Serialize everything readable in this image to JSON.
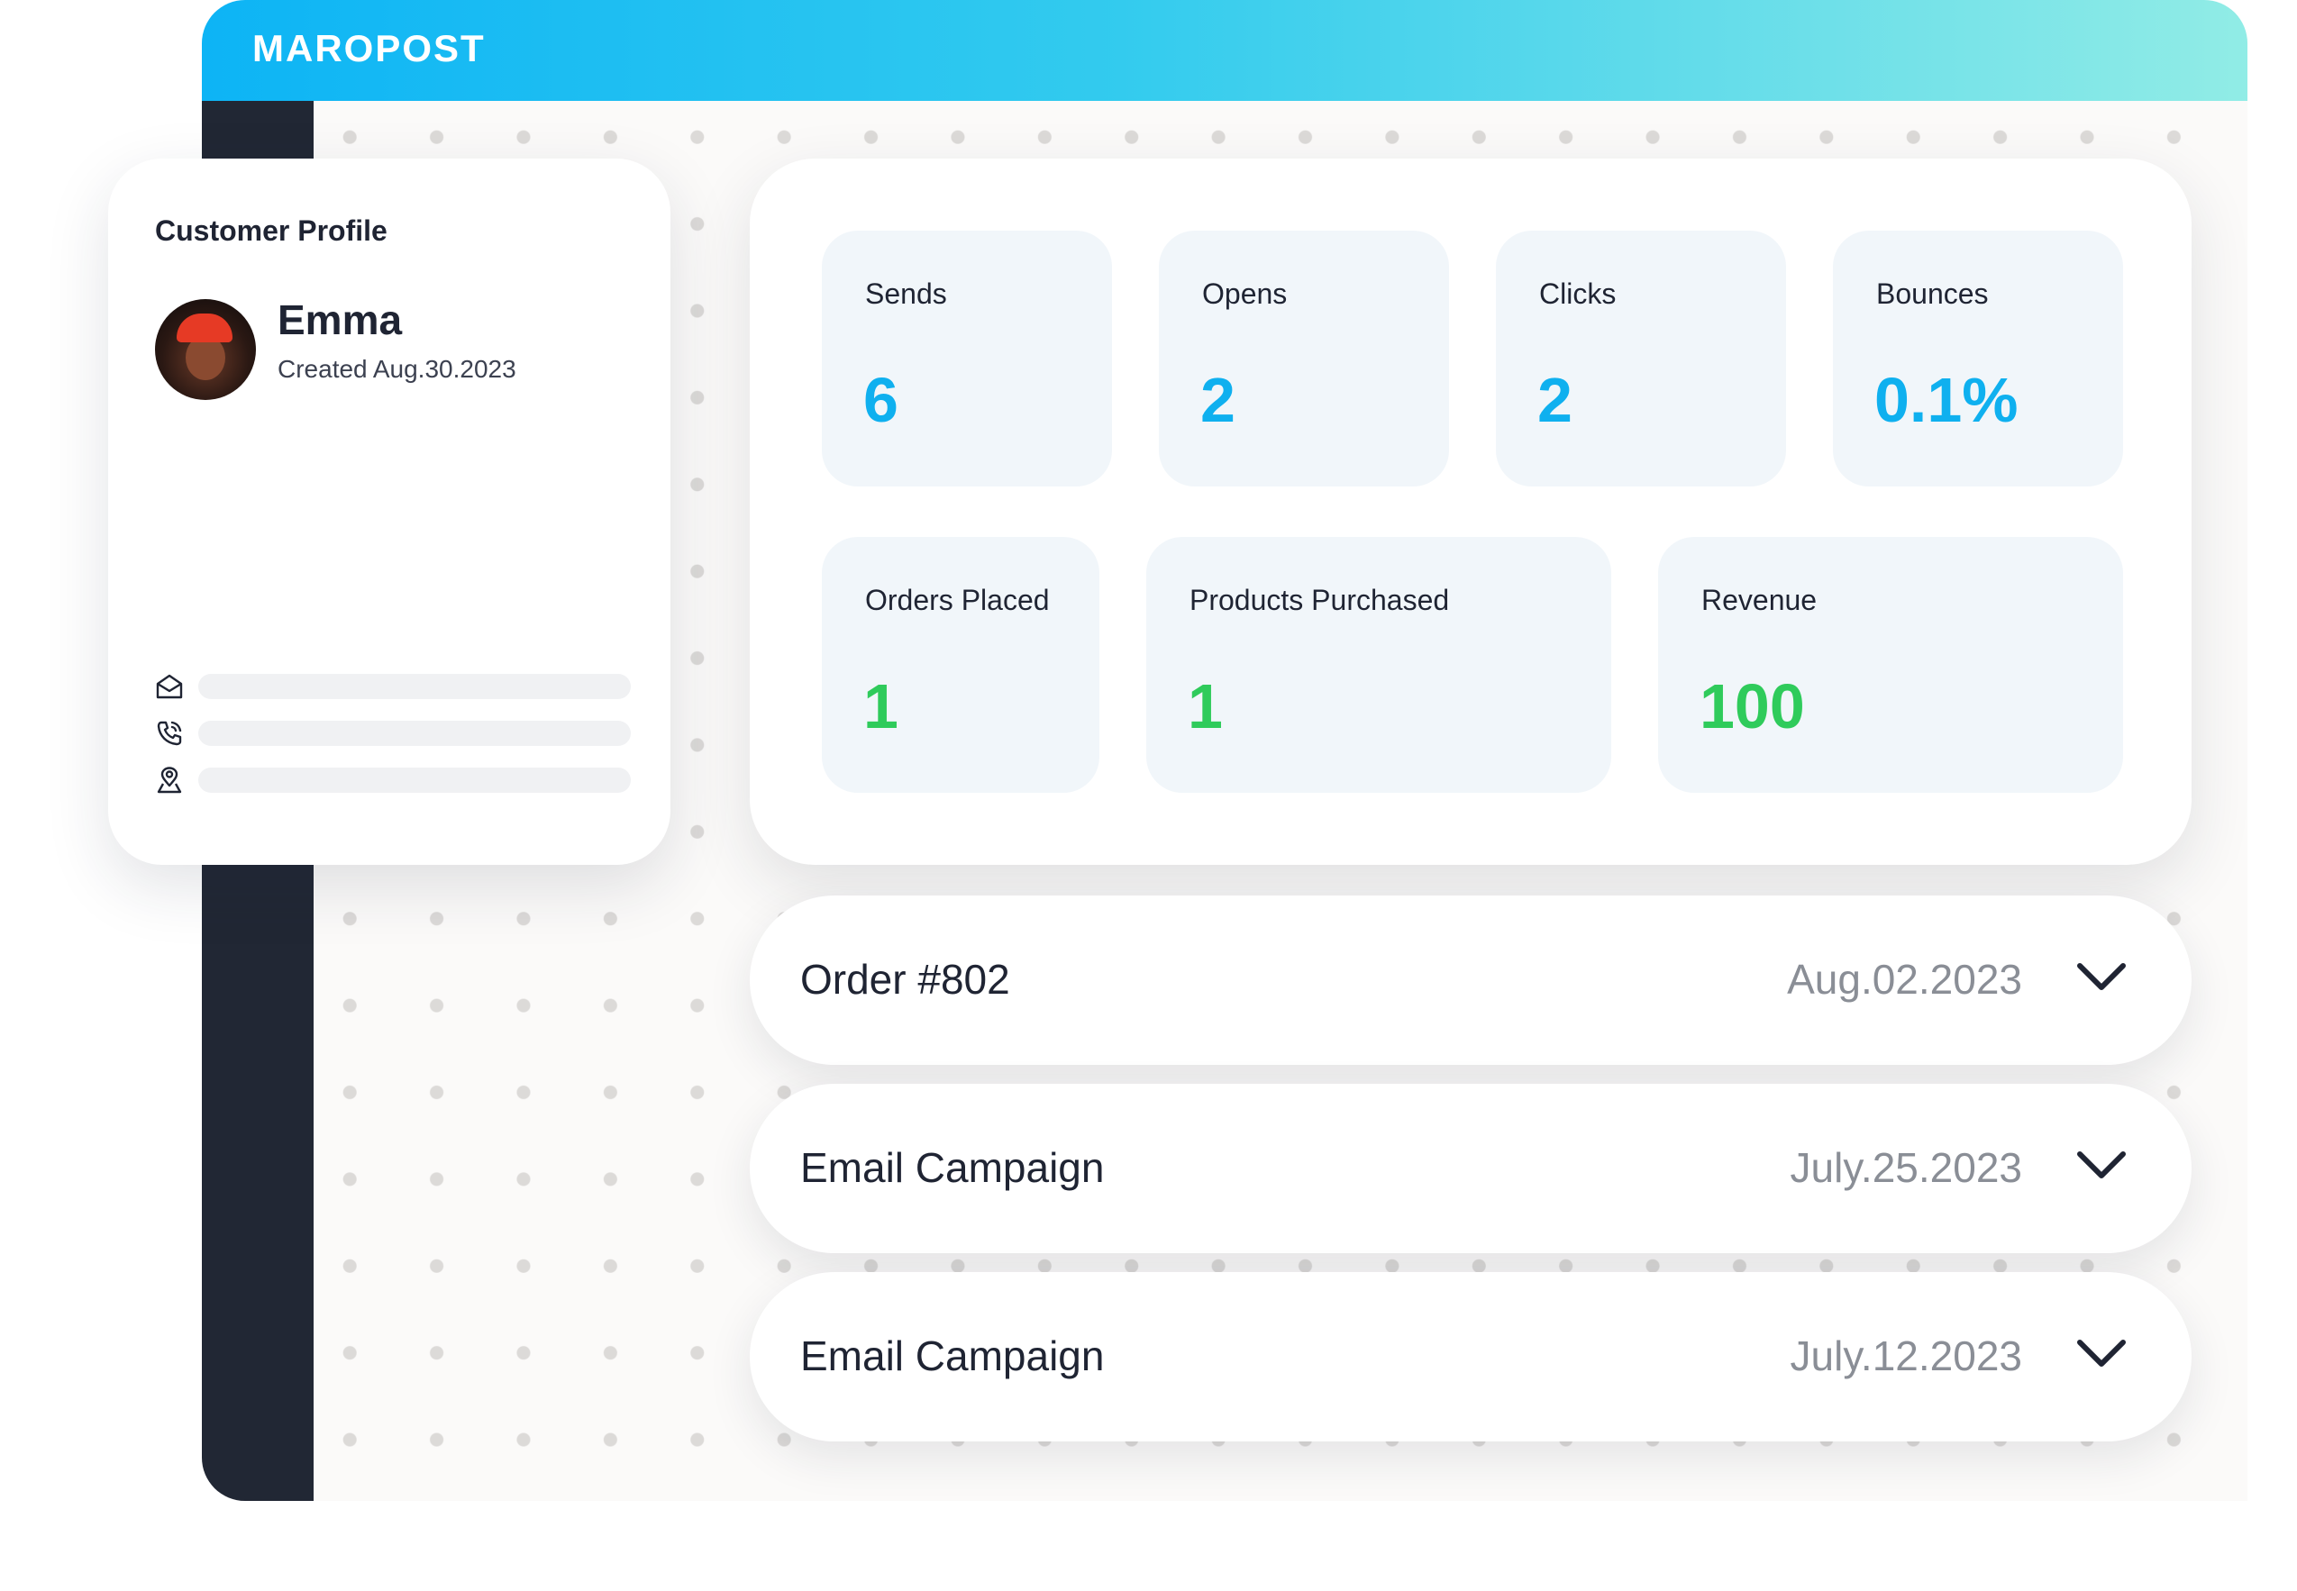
{
  "app": {
    "brand": "MAROPOST"
  },
  "profile": {
    "title": "Customer Profile",
    "name": "Emma",
    "created": "Created  Aug.30.2023",
    "contact_icons": [
      "mail-icon",
      "phone-icon",
      "location-icon"
    ]
  },
  "stats": {
    "sends": {
      "label": "Sends",
      "value": "6"
    },
    "opens": {
      "label": "Opens",
      "value": "2"
    },
    "clicks": {
      "label": "Clicks",
      "value": "2"
    },
    "bounces": {
      "label": "Bounces",
      "value": "0.1%"
    },
    "orders_placed": {
      "label": "Orders Placed",
      "value": "1"
    },
    "products_purchased": {
      "label": "Products Purchased",
      "value": "1"
    },
    "revenue": {
      "label": "Revenue",
      "value": "100"
    }
  },
  "activity": [
    {
      "title": "Order #802",
      "date": "Aug.02.2023"
    },
    {
      "title": "Email Campaign",
      "date": "July.25.2023"
    },
    {
      "title": "Email Campaign",
      "date": "July.12.2023"
    }
  ],
  "colors": {
    "engagement_value": "#0fb0ef",
    "commerce_value": "#2fcb5b",
    "sidebar": "#212734",
    "header_start": "#0db4f5",
    "header_end": "#91ece6"
  }
}
